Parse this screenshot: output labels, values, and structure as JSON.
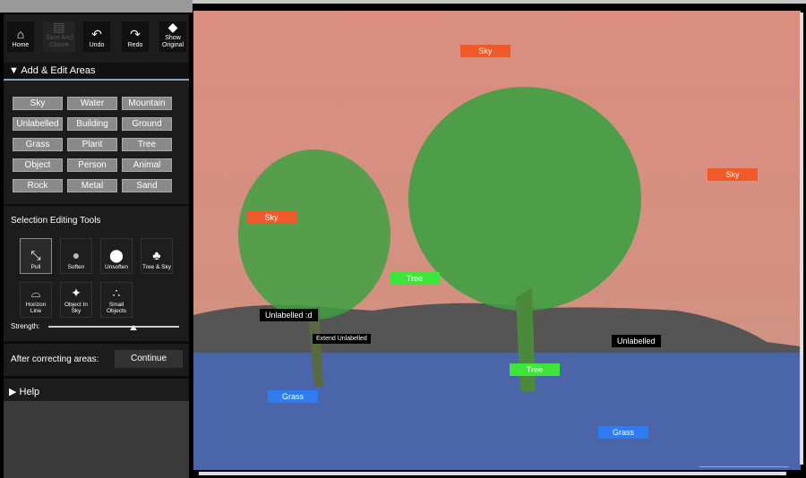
{
  "toolbar": {
    "home": "Home",
    "save": "Save And Close▾",
    "undo": "Undo",
    "redo": "Redo",
    "show_original": "Show Original"
  },
  "add_edit": {
    "title": "▼ Add & Edit Areas",
    "labels": [
      "Sky",
      "Water",
      "Mountain",
      "Unlabelled",
      "Building",
      "Ground",
      "Grass",
      "Plant",
      "Tree",
      "Object",
      "Person",
      "Animal",
      "Rock",
      "Metal",
      "Sand"
    ]
  },
  "tools": {
    "title": "Selection Editing Tools",
    "items": [
      "Pull",
      "Soften",
      "Unsoften",
      "Tree & Sky",
      "Horizon Line",
      "Object In Sky",
      "Small Objects"
    ],
    "strength_label": "Strength:",
    "strength": 0.65
  },
  "after": {
    "label": "After correcting areas:",
    "button": "Continue"
  },
  "help": "▶ Help",
  "scene": {
    "labels": [
      {
        "t": "Sky",
        "k": "sky"
      },
      {
        "t": "Sky",
        "k": "sky"
      },
      {
        "t": "Sky",
        "k": "sky"
      },
      {
        "t": "Tree",
        "k": "tree"
      },
      {
        "t": "Tree",
        "k": "tree"
      },
      {
        "t": "Unlabelled :d",
        "k": "unl"
      },
      {
        "t": "Unlabelled",
        "k": "unl"
      },
      {
        "t": "Grass",
        "k": "grass"
      },
      {
        "t": "Grass",
        "k": "grass"
      }
    ],
    "tooltip": "Extend Unlabelled"
  }
}
